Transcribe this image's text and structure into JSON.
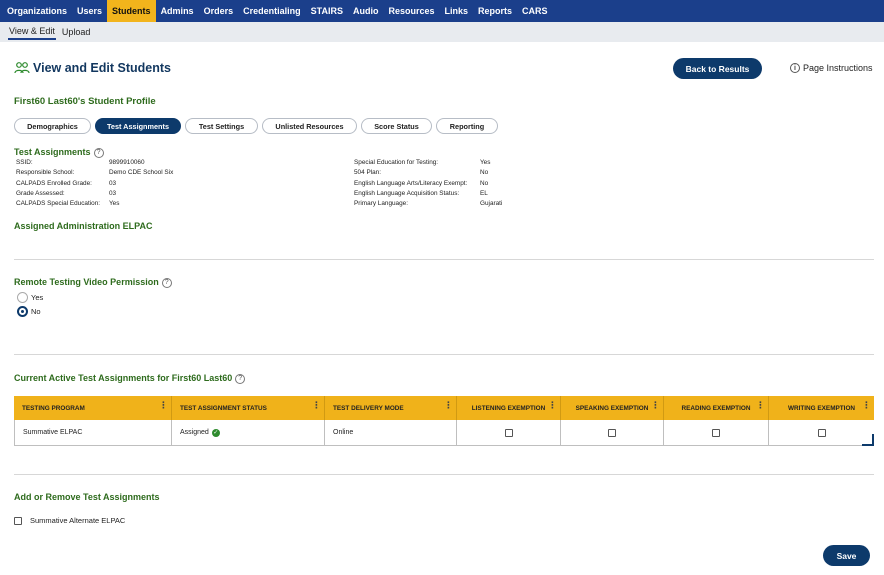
{
  "topnav": {
    "items": [
      "Organizations",
      "Users",
      "Students",
      "Admins",
      "Orders",
      "Credentialing",
      "STAIRS",
      "Audio",
      "Resources",
      "Links",
      "Reports",
      "CARS"
    ],
    "active_index": 2
  },
  "subnav": {
    "items": [
      "View & Edit",
      "Upload"
    ],
    "active_index": 0
  },
  "page": {
    "title": "View and Edit Students",
    "back_label": "Back to Results",
    "instructions_label": "Page Instructions",
    "profile_title": "First60 Last60's Student Profile"
  },
  "tabs": [
    "Demographics",
    "Test Assignments",
    "Test Settings",
    "Unlisted Resources",
    "Score Status",
    "Reporting"
  ],
  "active_tab": 1,
  "assignments": {
    "title": "Test Assignments",
    "left": [
      {
        "label": "SSID:",
        "value": "9899910060"
      },
      {
        "label": "Responsible School:",
        "value": "Demo CDE School Six"
      },
      {
        "label": "CALPADS Enrolled Grade:",
        "value": "03"
      },
      {
        "label": "Grade Assessed:",
        "value": "03"
      },
      {
        "label": "CALPADS Special Education:",
        "value": "Yes"
      }
    ],
    "right": [
      {
        "label": "Special Education for Testing:",
        "value": "Yes"
      },
      {
        "label": "504 Plan:",
        "value": "No"
      },
      {
        "label": "English Language Arts/Literacy Exempt:",
        "value": "No"
      },
      {
        "label": "English Language Acquisition Status:",
        "value": "EL"
      },
      {
        "label": "Primary Language:",
        "value": "Gujarati"
      }
    ],
    "assigned_admin": "Assigned Administration ELPAC"
  },
  "remote": {
    "title": "Remote Testing Video Permission",
    "options": [
      "Yes",
      "No"
    ],
    "selected": "No"
  },
  "current": {
    "title": "Current Active Test Assignments for First60 Last60",
    "headers": [
      "TESTING PROGRAM",
      "TEST ASSIGNMENT STATUS",
      "TEST DELIVERY MODE",
      "LISTENING EXEMPTION",
      "SPEAKING EXEMPTION",
      "READING EXEMPTION",
      "WRITING EXEMPTION"
    ],
    "rows": [
      {
        "program": "Summative ELPAC",
        "status": "Assigned",
        "mode": "Online",
        "listening": false,
        "speaking": false,
        "reading": false,
        "writing": false
      }
    ]
  },
  "add_remove": {
    "title": "Add or Remove Test Assignments",
    "options": [
      {
        "label": "Summative Alternate ELPAC",
        "checked": false
      }
    ]
  },
  "save_label": "Save",
  "colors": {
    "nav_bg": "#1b3f8b",
    "nav_active": "#f2b41c",
    "button": "#0d3a6b",
    "section_green": "#2e6b1d",
    "grid_header": "#f0b21a"
  }
}
